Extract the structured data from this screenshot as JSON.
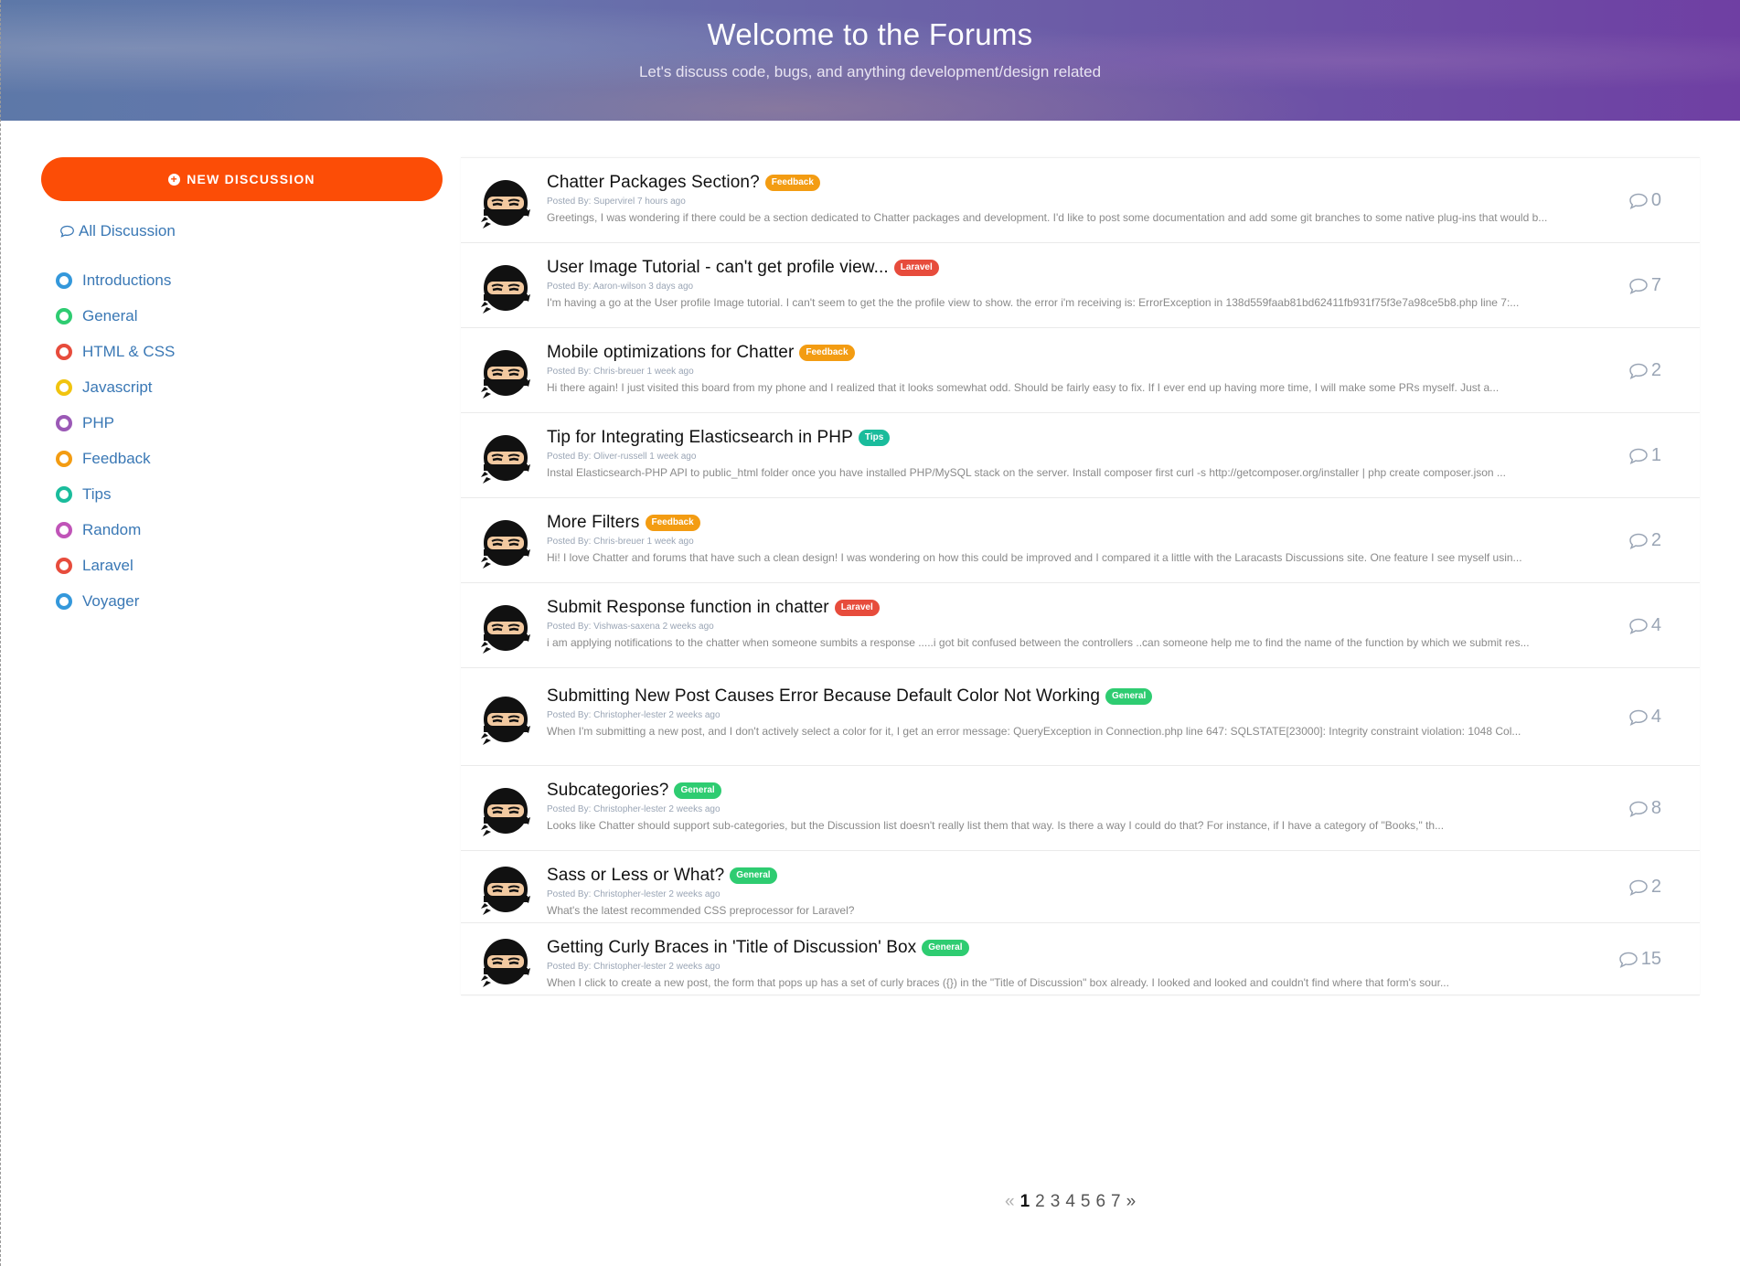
{
  "header": {
    "title": "Welcome to the Forums",
    "subtitle": "Let's discuss code, bugs, and anything development/design related"
  },
  "sidebar": {
    "new_discussion_label": "NEW DISCUSSION",
    "all_discussion_label": "All Discussion",
    "categories": [
      {
        "label": "Introductions",
        "color": "#3498db"
      },
      {
        "label": "General",
        "color": "#2ecc71"
      },
      {
        "label": "HTML & CSS",
        "color": "#e74c3c"
      },
      {
        "label": "Javascript",
        "color": "#f1c40f"
      },
      {
        "label": "PHP",
        "color": "#9b59b6"
      },
      {
        "label": "Feedback",
        "color": "#f39c12"
      },
      {
        "label": "Tips",
        "color": "#1abc9c"
      },
      {
        "label": "Random",
        "color": "#c054b8"
      },
      {
        "label": "Laravel",
        "color": "#e74c3c"
      },
      {
        "label": "Voyager",
        "color": "#3498db"
      }
    ]
  },
  "posted_by_label": "Posted By:",
  "discussions": [
    {
      "title": "Chatter Packages Section?",
      "badge": "Feedback",
      "badge_color": "#f39c12",
      "author": "Supervirel",
      "time": "7 hours ago",
      "snippet": "Greetings, I was wondering if there could be a section dedicated to Chatter packages and development. I'd like to post some documentation and add some git branches to some native plug-ins that would b...",
      "replies": "0"
    },
    {
      "title": "User Image Tutorial - can't get profile view...",
      "badge": "Laravel",
      "badge_color": "#e74c3c",
      "author": "Aaron-wilson",
      "time": "3 days ago",
      "snippet": "I'm having a go at the User profile Image tutorial. I can't seem to get the the profile view to show. the error i'm receiving is: ErrorException in 138d559faab81bd62411fb931f75f3e7a98ce5b8.php line 7:...",
      "replies": "7"
    },
    {
      "title": "Mobile optimizations for Chatter",
      "badge": "Feedback",
      "badge_color": "#f39c12",
      "author": "Chris-breuer",
      "time": "1 week ago",
      "snippet": "Hi there again! I just visited this board from my phone and I realized that it looks somewhat odd. Should be fairly easy to fix. If I ever end up having more time, I will make some PRs myself. Just a...",
      "replies": "2"
    },
    {
      "title": "Tip for Integrating Elasticsearch in PHP",
      "badge": "Tips",
      "badge_color": "#1abc9c",
      "author": "Oliver-russell",
      "time": "1 week ago",
      "snippet": "Instal Elasticsearch-PHP API to public_html folder once you have installed PHP/MySQL stack on the server. Install composer first curl -s http://getcomposer.org/installer | php create composer.json ...",
      "replies": "1"
    },
    {
      "title": "More Filters",
      "badge": "Feedback",
      "badge_color": "#f39c12",
      "author": "Chris-breuer",
      "time": "1 week ago",
      "snippet": "Hi! I love Chatter and forums that have such a clean design! I was wondering on how this could be improved and I compared it a little with the Laracasts Discussions site. One feature I see myself usin...",
      "replies": "2"
    },
    {
      "title": "Submit Response function in chatter",
      "badge": "Laravel",
      "badge_color": "#e74c3c",
      "author": "Vishwas-saxena",
      "time": "2 weeks ago",
      "snippet": "i am applying notifications to the chatter when someone sumbits a response .....i got bit confused between the controllers ..can someone help me to find the name of the function by which we submit res...",
      "replies": "4"
    },
    {
      "title": "Submitting New Post Causes Error Because Default Color Not Working",
      "badge": "General",
      "badge_color": "#2ecc71",
      "author": "Christopher-lester",
      "time": "2 weeks ago",
      "snippet": "When I'm submitting a new post, and I don't actively select a color for it, I get an error message: QueryException in Connection.php line 647: SQLSTATE[23000]: Integrity constraint violation: 1048 Col...",
      "replies": "4"
    },
    {
      "title": "Subcategories?",
      "badge": "General",
      "badge_color": "#2ecc71",
      "author": "Christopher-lester",
      "time": "2 weeks ago",
      "snippet": "Looks like Chatter should support sub-categories, but the Discussion list doesn't really list them that way. Is there a way I could do that? For instance, if I have a category of \"Books,\" th...",
      "replies": "8"
    },
    {
      "title": "Sass or Less or What?",
      "badge": "General",
      "badge_color": "#2ecc71",
      "author": "Christopher-lester",
      "time": "2 weeks ago",
      "snippet": "What's the latest recommended CSS preprocessor for Laravel?",
      "replies": "2"
    },
    {
      "title": "Getting Curly Braces in 'Title of Discussion' Box",
      "badge": "General",
      "badge_color": "#2ecc71",
      "author": "Christopher-lester",
      "time": "2 weeks ago",
      "snippet": "When I click to create a new post, the form that pops up has a set of curly braces ({}) in the \"Title of Discussion\" box already. I looked and looked and couldn't find where that form's sour...",
      "replies": "15"
    }
  ],
  "pagination": {
    "prev": "«",
    "pages": [
      "1",
      "2",
      "3",
      "4",
      "5",
      "6",
      "7"
    ],
    "current": "1",
    "next": "»"
  }
}
